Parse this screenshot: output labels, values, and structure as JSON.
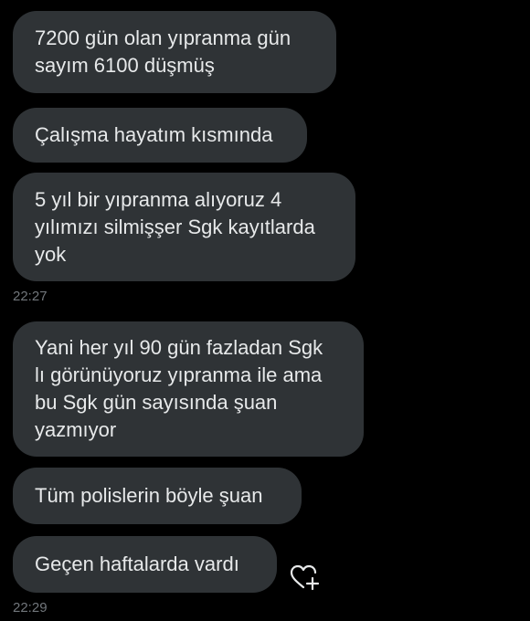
{
  "conversation": {
    "messages": [
      {
        "text": "7200 gün olan yıpranma gün\nsayım 6100 düşmüş"
      },
      {
        "text": "Çalışma hayatım kısmında"
      },
      {
        "text": "5 yıl bir yıpranma alıyoruz 4\nyılımızı silmişşer Sgk kayıtlarda\nyok"
      },
      {
        "text": "Yani her yıl 90 gün fazladan Sgk\nlı görünüyoruz yıpranma ile ama\nbu Sgk gün sayısında şuan\nyazmıyor"
      },
      {
        "text": "Tüm polislerin böyle şuan"
      },
      {
        "text": "Geçen haftalarda vardı"
      }
    ],
    "timestamps": [
      "22:27",
      "22:29"
    ]
  },
  "icons": {
    "react": "heart-plus-icon"
  },
  "colors": {
    "background": "#000000",
    "bubble": "#2f3336",
    "text": "#e7e9ea",
    "timestamp": "#71767b"
  }
}
